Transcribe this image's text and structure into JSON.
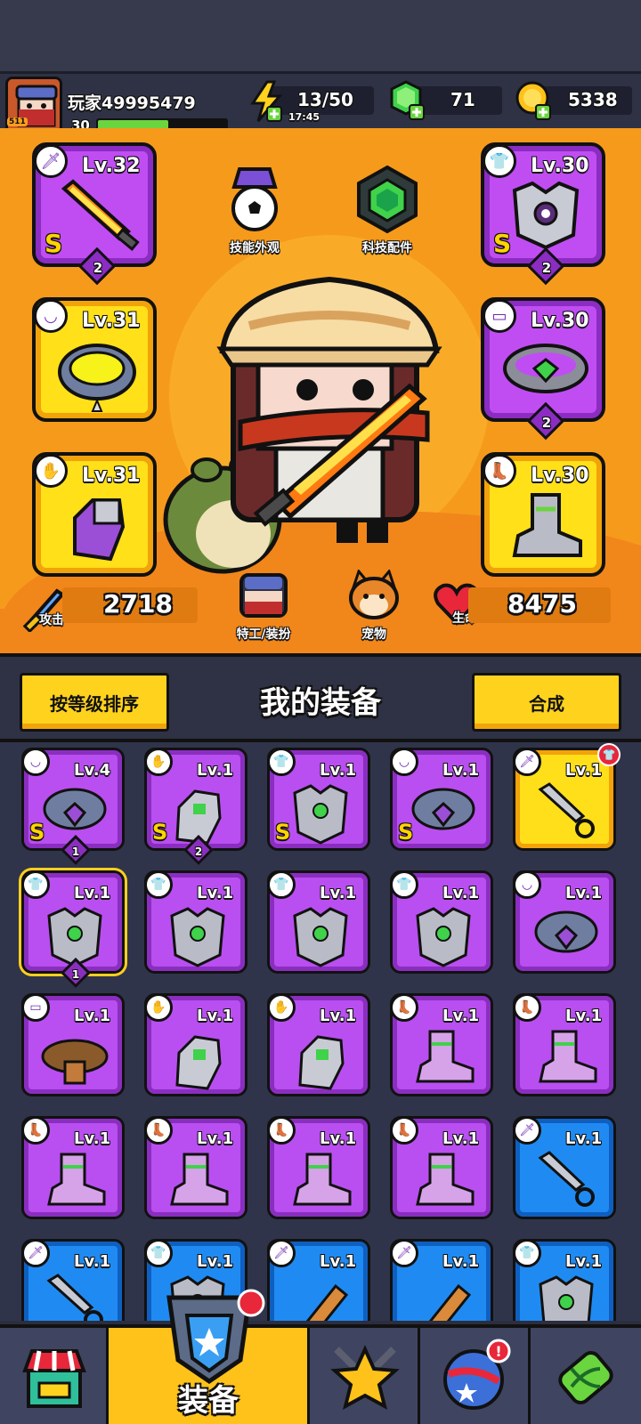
{
  "player": {
    "name": "玩家49995479",
    "level": "30",
    "xp_fraction": 0.55,
    "avatar_level": "511"
  },
  "resources": {
    "energy": "13/50",
    "energy_timer": "17:45",
    "gems": "71",
    "coins": "5338"
  },
  "hero": {
    "skin_label": "技能外观",
    "tech_label": "科技配件",
    "agent_label": "特工/装扮",
    "pet_label": "宠物",
    "attack_label": "攻击",
    "attack_value": "2718",
    "hp_label": "生命",
    "hp_value": "8475",
    "slots": [
      {
        "lv": "Lv.32",
        "grade": "S",
        "stars": "2",
        "icon": "sword-icon",
        "kind": "weapon"
      },
      {
        "lv": "Lv.30",
        "grade": "S",
        "stars": "2",
        "icon": "armor-icon",
        "kind": "armor"
      },
      {
        "lv": "Lv.31",
        "grade": "",
        "stars": "",
        "icon": "necklace-icon",
        "kind": "necklace"
      },
      {
        "lv": "Lv.30",
        "grade": "",
        "stars": "2",
        "icon": "belt-icon",
        "kind": "belt"
      },
      {
        "lv": "Lv.31",
        "grade": "",
        "stars": "",
        "icon": "glove-icon",
        "kind": "gloves"
      },
      {
        "lv": "Lv.30",
        "grade": "",
        "stars": "",
        "icon": "boot-icon",
        "kind": "boots"
      }
    ]
  },
  "equipment_header": {
    "sort_button": "按等级排序",
    "title": "我的装备",
    "merge_button": "合成",
    "alert": "!"
  },
  "inventory": [
    {
      "lv": "Lv.4",
      "grade": "S",
      "stars": "1",
      "color": "purple",
      "icon": "necklace-icon"
    },
    {
      "lv": "Lv.1",
      "grade": "S",
      "stars": "2",
      "color": "purple",
      "icon": "glove-icon"
    },
    {
      "lv": "Lv.1",
      "grade": "S",
      "stars": "",
      "color": "purple",
      "icon": "armor-icon"
    },
    {
      "lv": "Lv.1",
      "grade": "S",
      "stars": "",
      "color": "purple",
      "icon": "necklace-icon"
    },
    {
      "lv": "Lv.1",
      "grade": "",
      "stars": "",
      "color": "yellow",
      "icon": "kunai-icon",
      "new": true
    },
    {
      "lv": "Lv.1",
      "grade": "",
      "stars": "1",
      "color": "purple",
      "icon": "armor-icon",
      "selected": true
    },
    {
      "lv": "Lv.1",
      "grade": "",
      "stars": "",
      "color": "purple",
      "icon": "armor-icon"
    },
    {
      "lv": "Lv.1",
      "grade": "",
      "stars": "",
      "color": "purple",
      "icon": "armor-icon"
    },
    {
      "lv": "Lv.1",
      "grade": "",
      "stars": "",
      "color": "purple",
      "icon": "armor-icon"
    },
    {
      "lv": "Lv.1",
      "grade": "",
      "stars": "",
      "color": "purple",
      "icon": "necklace-icon"
    },
    {
      "lv": "Lv.1",
      "grade": "",
      "stars": "",
      "color": "purple",
      "icon": "belt-icon"
    },
    {
      "lv": "Lv.1",
      "grade": "",
      "stars": "",
      "color": "purple",
      "icon": "glove-icon"
    },
    {
      "lv": "Lv.1",
      "grade": "",
      "stars": "",
      "color": "purple",
      "icon": "glove-icon"
    },
    {
      "lv": "Lv.1",
      "grade": "",
      "stars": "",
      "color": "purple",
      "icon": "boot-icon"
    },
    {
      "lv": "Lv.1",
      "grade": "",
      "stars": "",
      "color": "purple",
      "icon": "boot-icon"
    },
    {
      "lv": "Lv.1",
      "grade": "",
      "stars": "",
      "color": "purple",
      "icon": "boot-icon"
    },
    {
      "lv": "Lv.1",
      "grade": "",
      "stars": "",
      "color": "purple",
      "icon": "boot-icon"
    },
    {
      "lv": "Lv.1",
      "grade": "",
      "stars": "",
      "color": "purple",
      "icon": "boot-icon"
    },
    {
      "lv": "Lv.1",
      "grade": "",
      "stars": "",
      "color": "purple",
      "icon": "boot-icon"
    },
    {
      "lv": "Lv.1",
      "grade": "",
      "stars": "",
      "color": "blue",
      "icon": "kunai-icon"
    },
    {
      "lv": "Lv.1",
      "grade": "",
      "stars": "",
      "color": "blue",
      "icon": "kunai-icon"
    },
    {
      "lv": "Lv.1",
      "grade": "",
      "stars": "",
      "color": "blue",
      "icon": "armor-icon"
    },
    {
      "lv": "Lv.1",
      "grade": "",
      "stars": "",
      "color": "blue",
      "icon": "club-icon"
    },
    {
      "lv": "Lv.1",
      "grade": "",
      "stars": "",
      "color": "blue",
      "icon": "club-icon"
    },
    {
      "lv": "Lv.1",
      "grade": "",
      "stars": "",
      "color": "blue",
      "icon": "armor-icon"
    }
  ],
  "nav": {
    "equip_label": "装备",
    "tabs": [
      "shop-icon",
      "equipment-icon",
      "star-icon",
      "planet-icon",
      "dna-icon"
    ]
  },
  "colors": {
    "orange_bg": "#f69a1c",
    "purple_rare": "#b94ff0",
    "yellow_legend": "#ffdf1a",
    "blue_common": "#1f8bf2",
    "alert_red": "#e8273a"
  }
}
